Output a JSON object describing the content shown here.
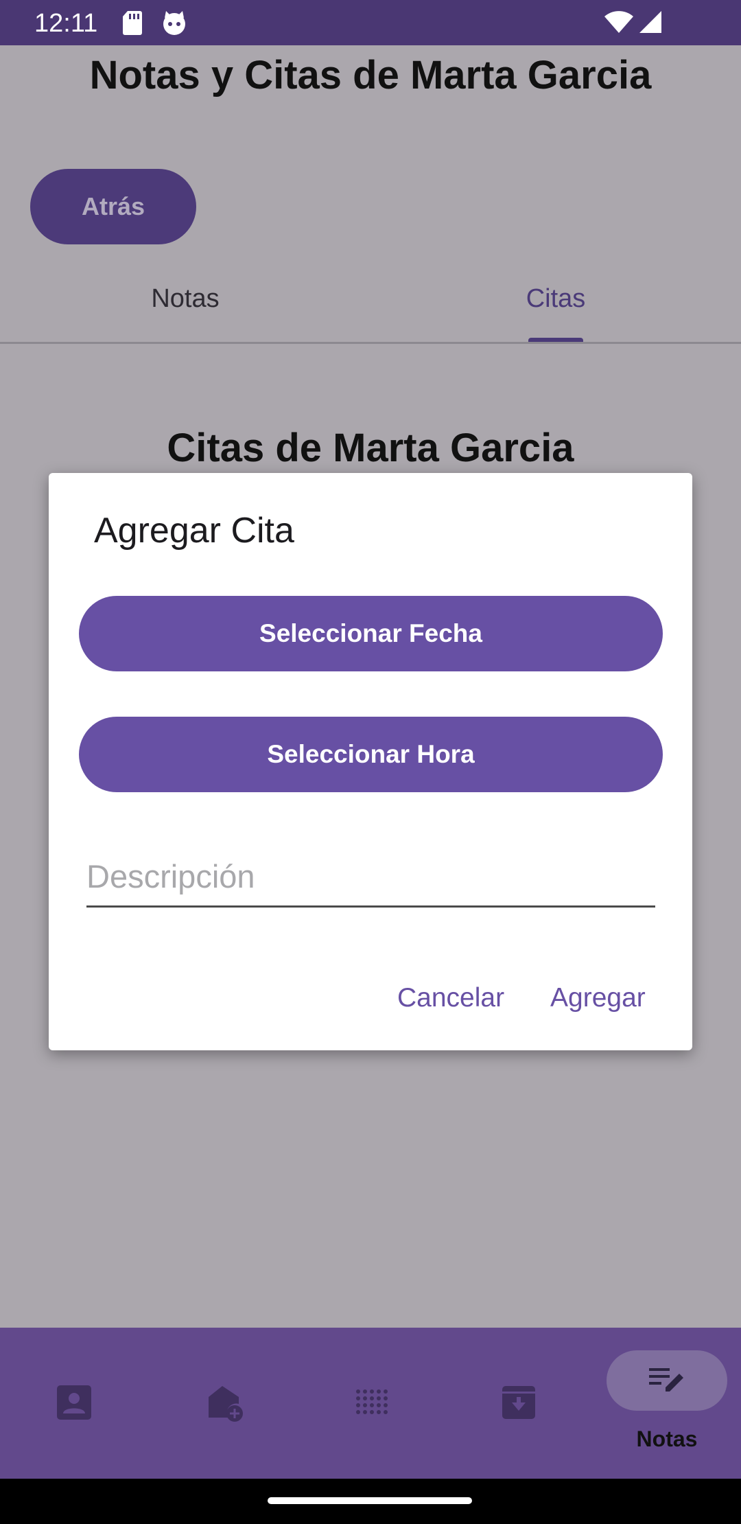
{
  "status_bar": {
    "time": "12:11",
    "left_icons": [
      "sd-card-icon",
      "cat-face-icon"
    ],
    "right_icons": [
      "wifi-icon",
      "cell-signal-icon"
    ]
  },
  "page": {
    "title": "Notas y Citas de Marta Garcia",
    "back_label": "Atrás"
  },
  "tabs": [
    {
      "label": "Notas",
      "selected": false
    },
    {
      "label": "Citas",
      "selected": true
    }
  ],
  "section_title": "Citas de Marta Garcia",
  "dialog": {
    "title": "Agregar Cita",
    "select_date_label": "Seleccionar Fecha",
    "select_time_label": "Seleccionar Hora",
    "description_placeholder": "Descripción",
    "description_value": "",
    "cancel_label": "Cancelar",
    "add_label": "Agregar"
  },
  "bottom_nav": {
    "items": [
      {
        "icon": "contact-icon"
      },
      {
        "icon": "add-home-icon"
      },
      {
        "icon": "grid-dots-icon"
      },
      {
        "icon": "archive-down-icon"
      },
      {
        "icon": "edit-notes-icon",
        "label": "Notas",
        "active": true
      }
    ]
  },
  "colors": {
    "primary": "#6750a4",
    "status_bar": "#4a3773",
    "scrim_background": "#aba7ad",
    "nav_bar": "#62498c"
  }
}
